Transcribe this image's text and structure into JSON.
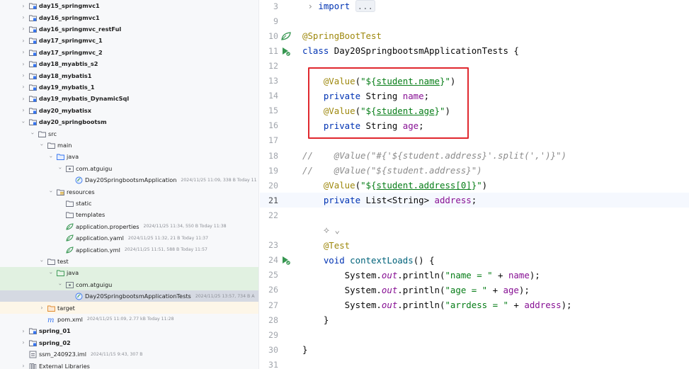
{
  "tree": {
    "items": [
      {
        "depth": 0,
        "state": "closed",
        "icon": "module-folder-icon",
        "label": "day15_springmvc1",
        "bold": true,
        "meta": ""
      },
      {
        "depth": 0,
        "state": "closed",
        "icon": "module-folder-icon",
        "label": "day16_springmvc1",
        "bold": true,
        "meta": ""
      },
      {
        "depth": 0,
        "state": "closed",
        "icon": "module-folder-icon",
        "label": "day16_springmvc_restFul",
        "bold": true,
        "meta": ""
      },
      {
        "depth": 0,
        "state": "closed",
        "icon": "module-folder-icon",
        "label": "day17_springmvc_1",
        "bold": true,
        "meta": ""
      },
      {
        "depth": 0,
        "state": "closed",
        "icon": "module-folder-icon",
        "label": "day17_springmvc_2",
        "bold": true,
        "meta": ""
      },
      {
        "depth": 0,
        "state": "closed",
        "icon": "module-folder-icon",
        "label": "day18_myabtis_s2",
        "bold": true,
        "meta": ""
      },
      {
        "depth": 0,
        "state": "closed",
        "icon": "module-folder-icon",
        "label": "day18_mybatis1",
        "bold": true,
        "meta": ""
      },
      {
        "depth": 0,
        "state": "closed",
        "icon": "module-folder-icon",
        "label": "day19_mybatis_1",
        "bold": true,
        "meta": ""
      },
      {
        "depth": 0,
        "state": "closed",
        "icon": "module-folder-icon",
        "label": "day19_mybatis_DynamicSql",
        "bold": true,
        "meta": ""
      },
      {
        "depth": 0,
        "state": "closed",
        "icon": "module-folder-icon",
        "label": "day20_mybatisx",
        "bold": true,
        "meta": ""
      },
      {
        "depth": 0,
        "state": "open",
        "icon": "module-folder-icon",
        "label": "day20_springbootsm",
        "bold": true,
        "meta": ""
      },
      {
        "depth": 1,
        "state": "open",
        "icon": "folder-icon",
        "label": "src",
        "bold": false,
        "meta": ""
      },
      {
        "depth": 2,
        "state": "open",
        "icon": "folder-icon",
        "label": "main",
        "bold": false,
        "meta": ""
      },
      {
        "depth": 3,
        "state": "open",
        "icon": "source-folder-icon",
        "label": "java",
        "bold": false,
        "meta": ""
      },
      {
        "depth": 4,
        "state": "open",
        "icon": "package-icon",
        "label": "com.atguigu",
        "bold": false,
        "meta": ""
      },
      {
        "depth": 5,
        "state": "none",
        "icon": "spring-class-icon",
        "label": "Day20SpringbootsmApplication",
        "bold": false,
        "meta": "2024/11/25 11:09, 338 B Today 11"
      },
      {
        "depth": 3,
        "state": "open",
        "icon": "resources-folder-icon",
        "label": "resources",
        "bold": false,
        "meta": ""
      },
      {
        "depth": 4,
        "state": "none",
        "icon": "folder-icon",
        "label": "static",
        "bold": false,
        "meta": ""
      },
      {
        "depth": 4,
        "state": "none",
        "icon": "folder-icon",
        "label": "templates",
        "bold": false,
        "meta": ""
      },
      {
        "depth": 4,
        "state": "none",
        "icon": "spring-config-icon",
        "label": "application.properties",
        "bold": false,
        "meta": "2024/11/25 11:34, 550 B Today 11:38"
      },
      {
        "depth": 4,
        "state": "none",
        "icon": "spring-config-icon",
        "label": "application.yaml",
        "bold": false,
        "meta": "2024/11/25 11:32, 21 B Today 11:37"
      },
      {
        "depth": 4,
        "state": "none",
        "icon": "spring-config-icon",
        "label": "application.yml",
        "bold": false,
        "meta": "2024/11/25 11:51, 588 B Today 11:57"
      },
      {
        "depth": 2,
        "state": "open",
        "icon": "folder-icon",
        "label": "test",
        "bold": false,
        "meta": ""
      },
      {
        "depth": 3,
        "state": "open",
        "icon": "test-folder-icon",
        "label": "java",
        "bold": false,
        "meta": "",
        "hl": true
      },
      {
        "depth": 4,
        "state": "open",
        "icon": "package-icon",
        "label": "com.atguigu",
        "bold": false,
        "meta": "",
        "hl": true
      },
      {
        "depth": 5,
        "state": "none",
        "icon": "spring-class-icon",
        "label": "Day20SpringbootsmApplicationTests",
        "bold": false,
        "meta": "2024/11/25 13:57, 734 B A",
        "sel": true
      },
      {
        "depth": 2,
        "state": "closed",
        "icon": "excluded-folder-icon",
        "label": "target",
        "bold": false,
        "meta": "",
        "tgt": true
      },
      {
        "depth": 2,
        "state": "none",
        "icon": "maven-icon",
        "label": "pom.xml",
        "bold": false,
        "meta": "2024/11/25 11:09, 2.77 kB Today 11:28"
      },
      {
        "depth": 0,
        "state": "closed",
        "icon": "module-folder-icon",
        "label": "spring_01",
        "bold": true,
        "meta": ""
      },
      {
        "depth": 0,
        "state": "closed",
        "icon": "module-folder-icon",
        "label": "spring_02",
        "bold": true,
        "meta": ""
      },
      {
        "depth": 0,
        "state": "none",
        "icon": "iml-file-icon",
        "label": "ssm_240923.iml",
        "bold": false,
        "meta": "2024/11/15 9:43, 307 B"
      },
      {
        "depth": 0,
        "state": "closed",
        "icon": "libraries-icon",
        "label": "External Libraries",
        "bold": false,
        "meta": ""
      }
    ]
  },
  "editor": {
    "lines": [
      {
        "n": "3",
        "gutter": "",
        "tokens": [
          [
            "fold",
            " › "
          ],
          [
            "kw",
            "import "
          ],
          [
            "foldbox",
            "..."
          ]
        ]
      },
      {
        "n": "9",
        "gutter": "",
        "tokens": []
      },
      {
        "n": "10",
        "gutter": "spring-bean-icon",
        "tokens": [
          [
            "an",
            "@SpringBootTest"
          ]
        ]
      },
      {
        "n": "11",
        "gutter": "run-test-icon",
        "tokens": [
          [
            "kw",
            "class "
          ],
          [
            "code",
            "Day20SpringbootsmApplicationTests {"
          ]
        ]
      },
      {
        "n": "12",
        "gutter": "",
        "tokens": []
      },
      {
        "n": "13",
        "gutter": "",
        "tokens": [
          [
            "code",
            "    "
          ],
          [
            "an",
            "@Value"
          ],
          [
            "code",
            "("
          ],
          [
            "st",
            "\"${"
          ],
          [
            "stu",
            "student.name"
          ],
          [
            "st",
            "}\""
          ],
          [
            "code",
            ")"
          ]
        ]
      },
      {
        "n": "14",
        "gutter": "",
        "tokens": [
          [
            "code",
            "    "
          ],
          [
            "kw",
            "private "
          ],
          [
            "code",
            "String "
          ],
          [
            "fd",
            "name"
          ],
          [
            "code",
            ";"
          ]
        ]
      },
      {
        "n": "15",
        "gutter": "",
        "tokens": [
          [
            "code",
            "    "
          ],
          [
            "an",
            "@Value"
          ],
          [
            "code",
            "("
          ],
          [
            "st",
            "\"${"
          ],
          [
            "stu",
            "student.age"
          ],
          [
            "st",
            "}\""
          ],
          [
            "code",
            ")"
          ]
        ]
      },
      {
        "n": "16",
        "gutter": "",
        "tokens": [
          [
            "code",
            "    "
          ],
          [
            "kw",
            "private "
          ],
          [
            "code",
            "String "
          ],
          [
            "fd",
            "age"
          ],
          [
            "code",
            ";"
          ]
        ]
      },
      {
        "n": "17",
        "gutter": "",
        "tokens": []
      },
      {
        "n": "18",
        "gutter": "",
        "tokens": [
          [
            "cm",
            "//    @Value(\"#{'${student.address}'.split(',')}\")"
          ]
        ]
      },
      {
        "n": "19",
        "gutter": "",
        "tokens": [
          [
            "cm",
            "//    @Value(\"${student.address}\")"
          ]
        ]
      },
      {
        "n": "20",
        "gutter": "",
        "tokens": [
          [
            "code",
            "    "
          ],
          [
            "an",
            "@Value"
          ],
          [
            "code",
            "("
          ],
          [
            "st",
            "\"${"
          ],
          [
            "stu",
            "student.address[0]"
          ],
          [
            "st",
            "}\""
          ],
          [
            "code",
            ")"
          ]
        ]
      },
      {
        "n": "21",
        "gutter": "",
        "cur": true,
        "tokens": [
          [
            "code",
            "    "
          ],
          [
            "kw",
            "private "
          ],
          [
            "code",
            "List<String> "
          ],
          [
            "fd",
            "address"
          ],
          [
            "code",
            ";"
          ]
        ]
      },
      {
        "n": "22",
        "gutter": "",
        "tokens": []
      },
      {
        "n": "",
        "gutter": "",
        "tokens": [
          [
            "code",
            "    "
          ],
          [
            "fold",
            "⟡ ⌄"
          ]
        ]
      },
      {
        "n": "23",
        "gutter": "",
        "tokens": [
          [
            "code",
            "    "
          ],
          [
            "an",
            "@Test"
          ]
        ]
      },
      {
        "n": "24",
        "gutter": "run-test-icon",
        "tokens": [
          [
            "code",
            "    "
          ],
          [
            "kw",
            "void "
          ],
          [
            "fn",
            "contextLoads"
          ],
          [
            "code",
            "() {"
          ]
        ]
      },
      {
        "n": "25",
        "gutter": "",
        "tokens": [
          [
            "code",
            "        System."
          ],
          [
            "it",
            "out"
          ],
          [
            "code",
            ".println("
          ],
          [
            "st",
            "\"name = \""
          ],
          [
            "code",
            " + "
          ],
          [
            "fd",
            "name"
          ],
          [
            "code",
            ");"
          ]
        ]
      },
      {
        "n": "26",
        "gutter": "",
        "tokens": [
          [
            "code",
            "        System."
          ],
          [
            "it",
            "out"
          ],
          [
            "code",
            ".println("
          ],
          [
            "st",
            "\"age = \""
          ],
          [
            "code",
            " + "
          ],
          [
            "fd",
            "age"
          ],
          [
            "code",
            ");"
          ]
        ]
      },
      {
        "n": "27",
        "gutter": "",
        "tokens": [
          [
            "code",
            "        System."
          ],
          [
            "it",
            "out"
          ],
          [
            "code",
            ".println("
          ],
          [
            "st",
            "\"arrdess = \""
          ],
          [
            "code",
            " + "
          ],
          [
            "fd",
            "address"
          ],
          [
            "code",
            ");"
          ]
        ]
      },
      {
        "n": "28",
        "gutter": "",
        "tokens": [
          [
            "code",
            "    }"
          ]
        ]
      },
      {
        "n": "29",
        "gutter": "",
        "tokens": []
      },
      {
        "n": "30",
        "gutter": "",
        "tokens": [
          [
            "code",
            "}"
          ]
        ]
      },
      {
        "n": "31",
        "gutter": "",
        "tokens": []
      }
    ]
  }
}
